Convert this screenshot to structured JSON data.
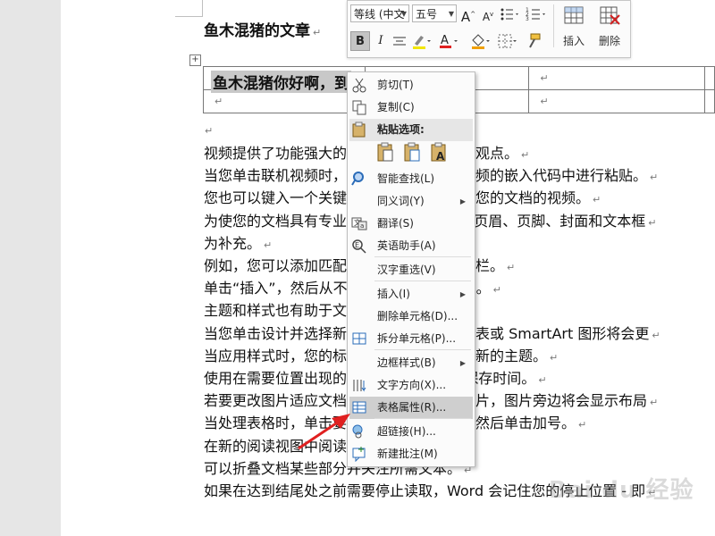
{
  "document": {
    "heading": "鱼木混猪的文章",
    "table_cell_text": "鱼木混猪你好啊，到",
    "paragraph_mark": "↵",
    "lines": [
      "视频提供了功能强大的方法帮助您证明您的观点。",
      "当您单击联机视频时，可以在想要添加的视频的嵌入代码中进行粘贴。",
      "您也可以键入一个关键字以联机搜索最适合您的文档的视频。",
      "为使您的文档具有专业外观，Word 提供了页眉、页脚、封面和文本框",
      "为补充。",
      "例如，您可以添加匹配的封面、页眉和提要栏。",
      "单击“插入”，然后从不同库中选择所需元素。",
      "主题和样式也有助于文档保持协调。",
      "当您单击设计并选择新的主题时，图片、图表或 SmartArt 图形将会更",
      "当应用样式时，您的标题会进行更改以匹配新的主题。",
      "使用在需要位置出现的新按钮在 Word 中保存时间。",
      "若要更改图片适应文档的方式，请单击该图片，图片旁边将会显示布局",
      "当处理表格时，单击要添加行或列的位置，然后单击加号。",
      "在新的阅读视图中阅读更加容易。",
      "可以折叠文档某些部分并关注所需文本。",
      "如果在达到结尾处之前需要停止读取，Word 会记住您的停止位置 - 即"
    ]
  },
  "mini_toolbar": {
    "font_name": "等线 (中文",
    "font_size": "五号",
    "grow_font": "A",
    "shrink_font": "A",
    "bold": "B",
    "italic": "I",
    "font_color_letter": "A",
    "insert_label": "插入",
    "delete_label": "删除",
    "colors": {
      "highlight": "#f2e600",
      "font_color": "#e02020",
      "shading": "#f0a000"
    }
  },
  "context_menu": {
    "items": [
      {
        "label": "剪切(T)",
        "icon": "scissors-icon"
      },
      {
        "label": "复制(C)",
        "icon": "copy-icon"
      },
      {
        "label": "粘贴选项:",
        "icon": "clipboard-icon"
      },
      {
        "label": "智能查找(L)",
        "icon": "magnifier-icon"
      },
      {
        "label": "同义词(Y)",
        "icon": "",
        "submenu": "▶"
      },
      {
        "label": "翻译(S)",
        "icon": "translate-icon"
      },
      {
        "label": "英语助手(A)",
        "icon": "english-assistant-icon"
      },
      {
        "label": "汉字重选(V)",
        "icon": ""
      },
      {
        "label": "插入(I)",
        "icon": "",
        "submenu": "▶"
      },
      {
        "label": "删除单元格(D)...",
        "icon": ""
      },
      {
        "label": "拆分单元格(P)...",
        "icon": "split-cells-icon"
      },
      {
        "label": "边框样式(B)",
        "icon": "",
        "submenu": "▶"
      },
      {
        "label": "文字方向(X)...",
        "icon": "text-direction-icon"
      },
      {
        "label": "表格属性(R)...",
        "icon": "table-properties-icon"
      },
      {
        "label": "超链接(H)...",
        "icon": "hyperlink-icon"
      },
      {
        "label": "新建批注(M)",
        "icon": "new-comment-icon"
      }
    ],
    "highlighted_index": 13
  },
  "watermark": "Bai du 经验"
}
